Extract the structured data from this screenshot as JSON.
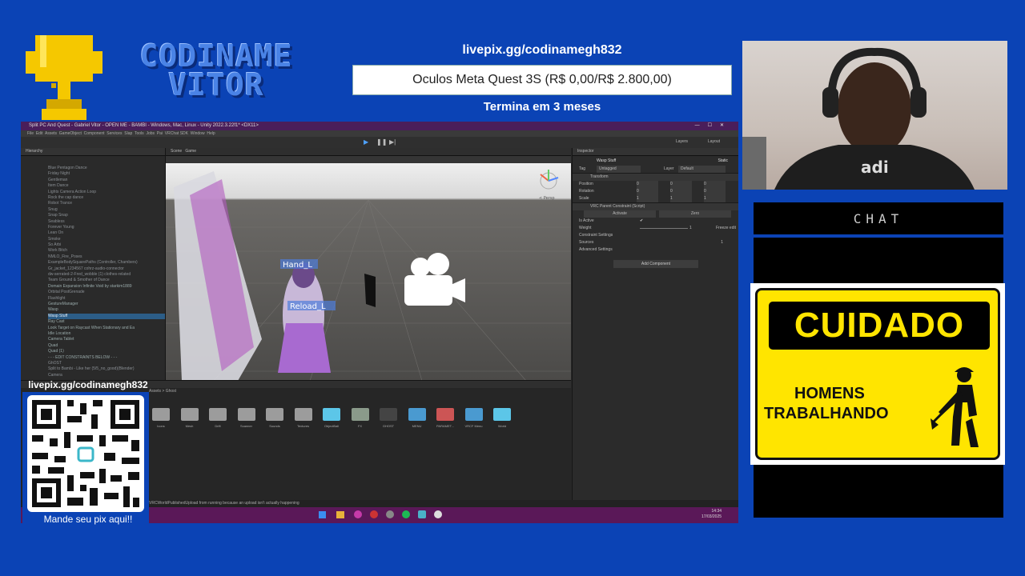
{
  "overlay": {
    "logo_text_line1": "CODINAME",
    "logo_text_line2": "VITOR",
    "goal": {
      "url": "livepix.gg/codinamegh832",
      "text": "Oculos Meta Quest 3S (R$ 0,00/R$ 2.800,00)",
      "progress": 0,
      "ends": "Termina em 3 meses"
    },
    "chat_label": "CHAT",
    "sign": {
      "title": "CUIDADO",
      "line1": "HOMENS",
      "line2": "TRABALHANDO"
    },
    "qr": {
      "url": "livepix.gg/codinamegh832",
      "caption": "Mande seu pix aqui!!"
    },
    "colors": {
      "background": "#0b43b5",
      "sign_yellow": "#ffe500",
      "title_bar": "#4a1e5a"
    }
  },
  "unity": {
    "title": "Split PC And Quest - Gabriel Vitor - OPEN ME - BAMBI - Windows, Mac, Linux - Unity 2022.3.22f1* <DX11>",
    "menu": [
      "File",
      "Edit",
      "Assets",
      "GameObject",
      "Component",
      "Services",
      "Slap",
      "Tools",
      "Jobs",
      "Pai",
      "VRChat SDK",
      "Window",
      "Help"
    ],
    "hierarchy_tab": "Hierarchy",
    "hierarchy": [
      {
        "label": "Blue Pentagon Dance",
        "dim": true
      },
      {
        "label": "Friday Night",
        "dim": true
      },
      {
        "label": "Gentleman",
        "dim": true
      },
      {
        "label": "Item Dance",
        "dim": true
      },
      {
        "label": "Lights Camera Action Loop",
        "dim": true
      },
      {
        "label": "Rock the cap dance",
        "dim": true
      },
      {
        "label": "Robot Trance",
        "dim": true
      },
      {
        "label": "Snug",
        "dim": true
      },
      {
        "label": "Snap Snap",
        "dim": true
      },
      {
        "label": "Seabless",
        "dim": true
      },
      {
        "label": "Forever Young",
        "dim": true
      },
      {
        "label": "Lean On",
        "dim": true
      },
      {
        "label": "Smoke",
        "dim": true
      },
      {
        "label": "So Arbi",
        "dim": true
      },
      {
        "label": "Work Bitch",
        "dim": true
      },
      {
        "label": "NMLO_Fire_Poses",
        "dim": true
      },
      {
        "label": "ExampleBodySquarePaths (Controller, Chambers)",
        "dim": true
      },
      {
        "label": "Gr_jacket_1234567 cohrz-audio-connector",
        "dim": true
      },
      {
        "label": "dw-serrated-2-Fred_wobble (1) clothes-related",
        "dim": true
      },
      {
        "label": "Team Ground & Smother of Dance",
        "dim": true
      },
      {
        "label": "Domain Expansion Infinite Void by starkim1889",
        "dim": false
      },
      {
        "label": "Orbital PostGrenade",
        "dim": true
      },
      {
        "label": "Flashlight",
        "dim": true
      },
      {
        "label": "GestureManager",
        "dim": false
      },
      {
        "label": "Wasp",
        "dim": false
      },
      {
        "label": "Wasp Stuff",
        "dim": false,
        "selected": true
      },
      {
        "label": "Ray Cast",
        "dim": false
      },
      {
        "label": "Look Target on Raycast When Stationary and Ea",
        "dim": false
      },
      {
        "label": "Idle Location",
        "dim": false
      },
      {
        "label": "Camera Tablet",
        "dim": false
      },
      {
        "label": "Quad",
        "dim": false
      },
      {
        "label": "Quad (1)",
        "dim": false
      },
      {
        "label": "- - - EDIT CONSTRAINTS BELOW - - -",
        "dim": false
      },
      {
        "label": "GhOST",
        "dim": true
      },
      {
        "label": "Split to Bambi - Like her (5/5_no_good)(Blender)",
        "dim": true
      },
      {
        "label": "Camera",
        "dim": true
      }
    ],
    "scene": {
      "tabs": [
        "Scene",
        "Game"
      ],
      "gizmo_label": "< Persp",
      "labels": [
        "Hand_L",
        "Reload_L"
      ]
    },
    "inspector": {
      "tab": "Inspector",
      "object_name": "Wasp Stuff",
      "static_label": "Static",
      "tag_label": "Tag",
      "tag_value": "Untagged",
      "layer_label": "Layer",
      "layer_value": "Default",
      "transform_title": "Transform",
      "rows": [
        {
          "label": "Position",
          "x": "0",
          "y": "0",
          "z": "0"
        },
        {
          "label": "Rotation",
          "x": "0",
          "y": "0",
          "z": "0"
        },
        {
          "label": "Scale",
          "x": "1",
          "y": "1",
          "z": "1"
        }
      ],
      "component_title": "VRC Parent Constraint (Script)",
      "activate_label": "Activate",
      "zero_label": "Zero",
      "is_active_label": "Is Active",
      "weight_label": "Weight",
      "weight_value": "1",
      "freeze_label": "Freeze edit",
      "constraint_settings": "Constraint Settings",
      "sources_label": "Sources",
      "sources_value": "1",
      "advanced_settings": "Advanced Settings",
      "add_component": "Add Component"
    },
    "project": {
      "breadcrumb": "Assets > Ghost",
      "items": [
        "Icons",
        "Mesh",
        "Drift",
        "Scanner",
        "Sounds",
        "Textures",
        "ObjectBall",
        "FX",
        "GHOST",
        "MENU",
        "PARAMET...",
        "VRCF Menu",
        "World"
      ]
    },
    "status": "VRCWorldPublishedUpload from running because an upload isn't actually happening",
    "taskbar": {
      "time": "14:34",
      "date": "17/03/2025"
    },
    "layers_label": "Layers",
    "layout_label": "Layout"
  }
}
